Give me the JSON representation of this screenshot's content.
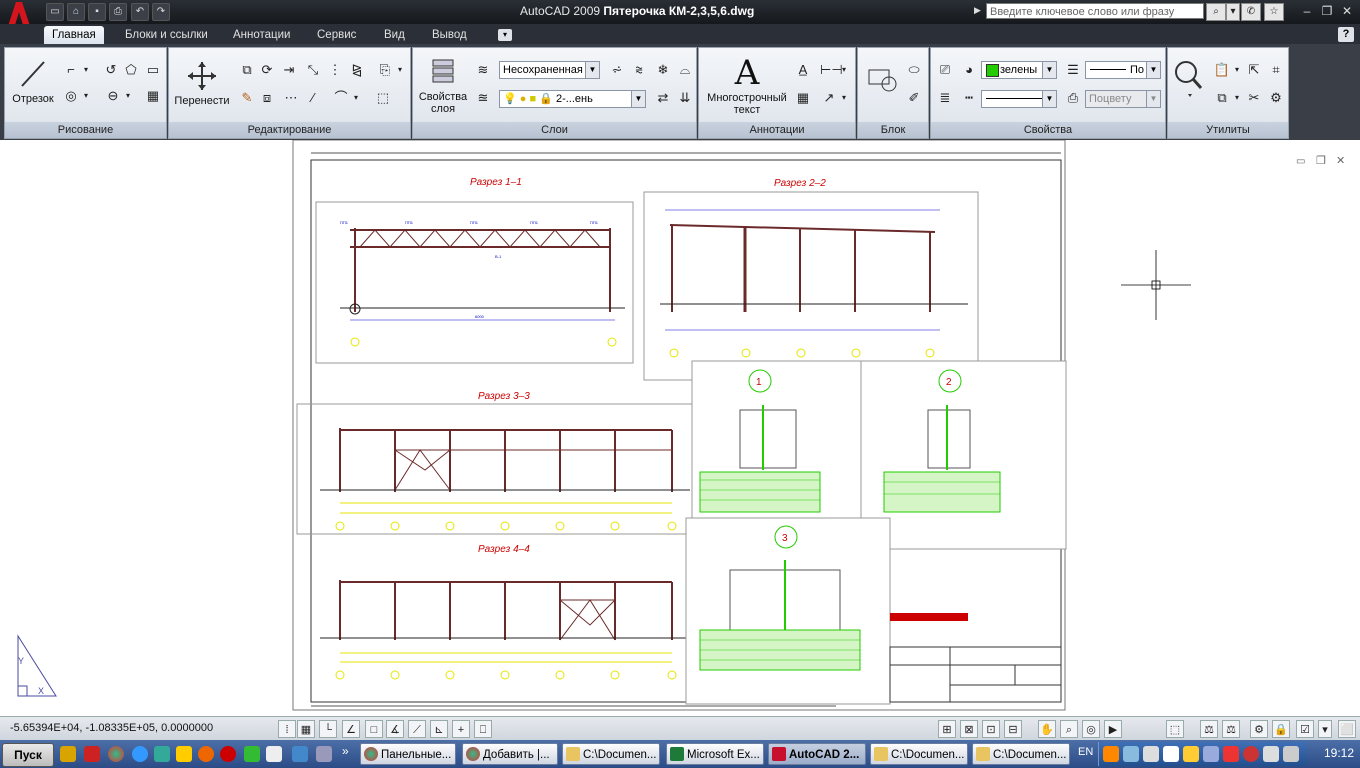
{
  "window": {
    "app_name": "AutoCAD 2009",
    "file_name": "Пятерочка КМ-2,3,5,6.dwg",
    "search_placeholder": "Введите ключевое слово или фразу"
  },
  "tabs": [
    "Главная",
    "Блоки и ссылки",
    "Аннотации",
    "Сервис",
    "Вид",
    "Вывод"
  ],
  "ribbon": {
    "draw": {
      "title": "Рисование",
      "line_label": "Отрезок"
    },
    "modify": {
      "title": "Редактирование",
      "move_label": "Перенести"
    },
    "layers": {
      "title": "Слои",
      "props_label_1": "Свойства",
      "props_label_2": "слоя",
      "layer_state": "Несохраненная",
      "current_layer": "2-...ень"
    },
    "annotation": {
      "title": "Аннотации",
      "mtext_label_1": "Многострочный",
      "mtext_label_2": "текст"
    },
    "block": {
      "title": "Блок"
    },
    "properties": {
      "title": "Свойства",
      "color": "зелены",
      "linetype": "По",
      "lineweight_value": "",
      "plot_style": "Поцвету"
    },
    "utilities": {
      "title": "Утилиты"
    }
  },
  "drawing": {
    "section_1": "Разрез 1–1",
    "section_2": "Разрез 2–2",
    "section_3": "Разрез 3–3",
    "section_4": "Разрез 4–4",
    "node_1": "1",
    "node_2": "2",
    "node_3": "3"
  },
  "status": {
    "coordinates": "-5.65394E+04, -1.08335E+05, 0.0000000"
  },
  "taskbar": {
    "start": "Пуск",
    "tasks": [
      "Панельные...",
      "Добавить |...",
      "C:\\Documen...",
      "Microsoft Ex...",
      "AutoCAD 2...",
      "C:\\Documen...",
      "C:\\Documen..."
    ],
    "lang": "EN",
    "clock": "19:12"
  },
  "colors": {
    "accent_red": "#c8102e",
    "drawing_red": "#cc0000",
    "drawing_blue": "#0000cc",
    "drawing_green": "#22cc00",
    "drawing_yellow": "#e6e600",
    "drawing_structure": "#6b2a2a"
  },
  "icons": [
    "autocad-logo-icon",
    "new-icon",
    "open-icon",
    "save-icon",
    "print-icon",
    "undo-icon",
    "redo-icon",
    "search-icon",
    "favorites-icon",
    "line-icon",
    "polyline-icon",
    "circle-icon",
    "arc-icon",
    "move-icon",
    "layer-properties-icon",
    "mtext-icon",
    "insert-block-icon",
    "zoom-icon",
    "ucs-icon",
    "crosshair-icon"
  ]
}
